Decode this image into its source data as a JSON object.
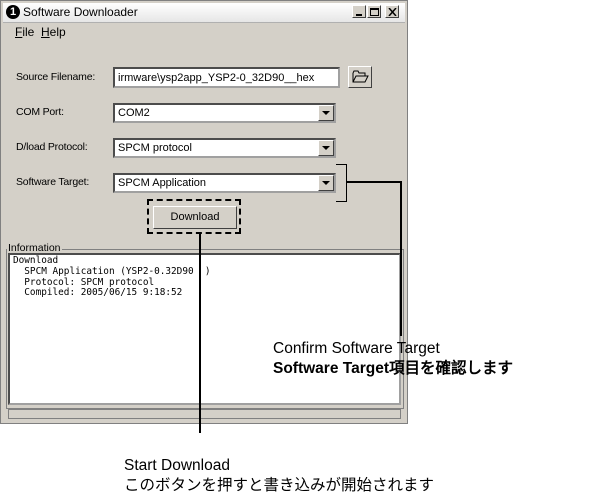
{
  "window": {
    "title": "Software Downloader",
    "icon_glyph": "1",
    "menu": [
      "File",
      "Help"
    ]
  },
  "form": {
    "source_filename_label": "Source Filename:",
    "source_filename_value": "irmware\\ysp2app_YSP2-0_32D90__hex",
    "com_port_label": "COM Port:",
    "com_port_value": "COM2",
    "dload_protocol_label": "D/load Protocol:",
    "dload_protocol_value": "SPCM protocol",
    "software_target_label": "Software Target:",
    "software_target_value": "SPCM Application",
    "download_button": "Download"
  },
  "information": {
    "legend": "Information",
    "log": "Download\n  SPCM Application (YSP2-0.32D90  )\n  Protocol: SPCM protocol\n  Compiled: 2005/06/15 9:18:52"
  },
  "annotations": {
    "confirm_en": "Confirm Software Target",
    "confirm_jp_bold": "Software Target",
    "confirm_jp_rest": "項目を確認します",
    "start_en": "Start Download",
    "start_jp": "このボタンを押すと書き込みが開始されます"
  },
  "icons": {
    "app": "app-logo-icon",
    "minimize": "minimize-icon",
    "maximize": "maximize-icon",
    "close": "close-icon",
    "browse": "folder-open-icon",
    "dropdown": "chevron-down-icon"
  }
}
